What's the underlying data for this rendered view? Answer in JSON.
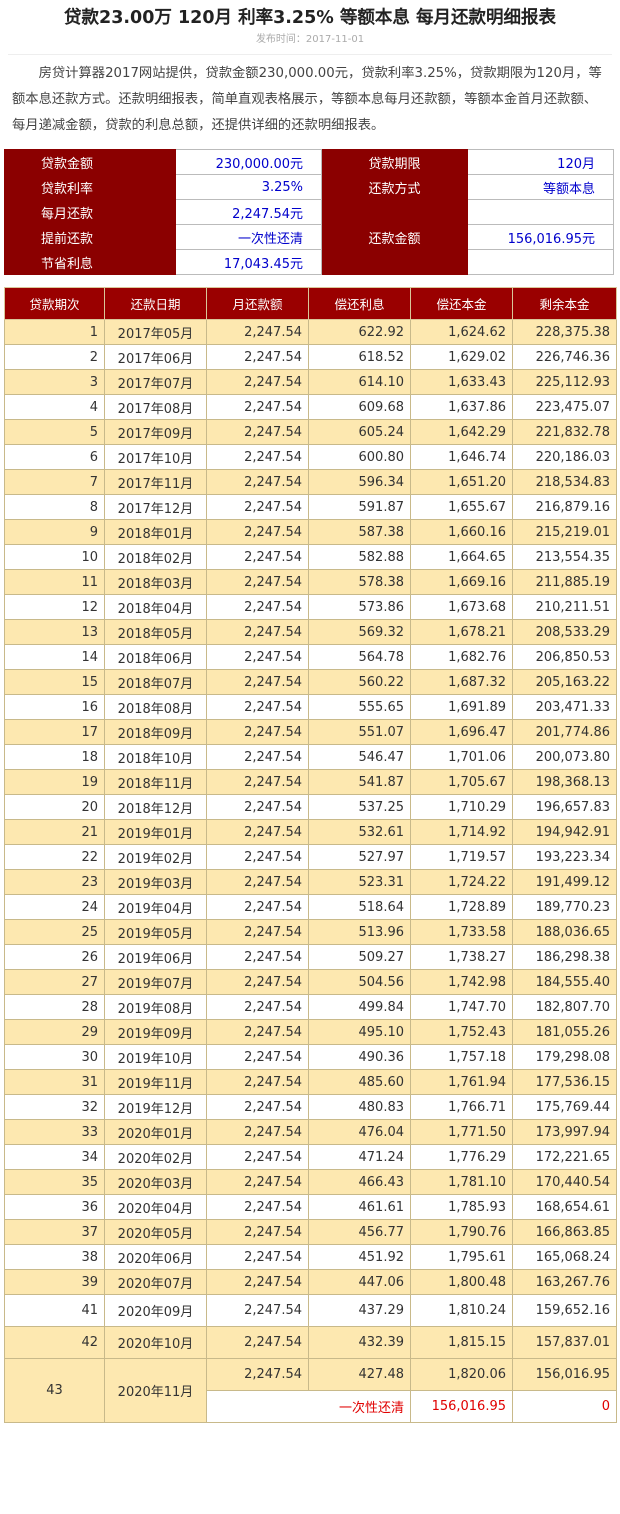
{
  "article": {
    "title": "贷款23.00万 120月 利率3.25% 等额本息 每月还款明细报表",
    "publish_date": "发布时间：2017-11-01",
    "intro": "房贷计算器2017网站提供，贷款金额230,000.00元，贷款利率3.25%，贷款期限为120月，等额本息还款方式。还款明细报表，简单直观表格展示，等额本息每月还款额，等额本金首月还款额、每月递减金额，贷款的利息总额，还提供详细的还款明细报表。"
  },
  "summary": {
    "loan_amount_label": "贷款金额",
    "loan_amount": "230,000.00元",
    "term_label": "贷款期限",
    "term": "120月",
    "rate_label": "贷款利率",
    "rate": "3.25%",
    "method_label": "还款方式",
    "method": "等额本息",
    "monthly_label": "每月还款",
    "monthly": "2,247.54元",
    "prepay_label": "提前还款",
    "prepay": "一次性还清",
    "prepay_amount_label": "还款金额",
    "prepay_amount": "156,016.95元",
    "saved_label": "节省利息",
    "saved": "17,043.45元"
  },
  "schedule": {
    "headers": [
      "贷款期次",
      "还款日期",
      "月还款额",
      "偿还利息",
      "偿还本金",
      "剩余本金"
    ],
    "rows": [
      [
        "1",
        "2017年05月",
        "2,247.54",
        "622.92",
        "1,624.62",
        "228,375.38"
      ],
      [
        "2",
        "2017年06月",
        "2,247.54",
        "618.52",
        "1,629.02",
        "226,746.36"
      ],
      [
        "3",
        "2017年07月",
        "2,247.54",
        "614.10",
        "1,633.43",
        "225,112.93"
      ],
      [
        "4",
        "2017年08月",
        "2,247.54",
        "609.68",
        "1,637.86",
        "223,475.07"
      ],
      [
        "5",
        "2017年09月",
        "2,247.54",
        "605.24",
        "1,642.29",
        "221,832.78"
      ],
      [
        "6",
        "2017年10月",
        "2,247.54",
        "600.80",
        "1,646.74",
        "220,186.03"
      ],
      [
        "7",
        "2017年11月",
        "2,247.54",
        "596.34",
        "1,651.20",
        "218,534.83"
      ],
      [
        "8",
        "2017年12月",
        "2,247.54",
        "591.87",
        "1,655.67",
        "216,879.16"
      ],
      [
        "9",
        "2018年01月",
        "2,247.54",
        "587.38",
        "1,660.16",
        "215,219.01"
      ],
      [
        "10",
        "2018年02月",
        "2,247.54",
        "582.88",
        "1,664.65",
        "213,554.35"
      ],
      [
        "11",
        "2018年03月",
        "2,247.54",
        "578.38",
        "1,669.16",
        "211,885.19"
      ],
      [
        "12",
        "2018年04月",
        "2,247.54",
        "573.86",
        "1,673.68",
        "210,211.51"
      ],
      [
        "13",
        "2018年05月",
        "2,247.54",
        "569.32",
        "1,678.21",
        "208,533.29"
      ],
      [
        "14",
        "2018年06月",
        "2,247.54",
        "564.78",
        "1,682.76",
        "206,850.53"
      ],
      [
        "15",
        "2018年07月",
        "2,247.54",
        "560.22",
        "1,687.32",
        "205,163.22"
      ],
      [
        "16",
        "2018年08月",
        "2,247.54",
        "555.65",
        "1,691.89",
        "203,471.33"
      ],
      [
        "17",
        "2018年09月",
        "2,247.54",
        "551.07",
        "1,696.47",
        "201,774.86"
      ],
      [
        "18",
        "2018年10月",
        "2,247.54",
        "546.47",
        "1,701.06",
        "200,073.80"
      ],
      [
        "19",
        "2018年11月",
        "2,247.54",
        "541.87",
        "1,705.67",
        "198,368.13"
      ],
      [
        "20",
        "2018年12月",
        "2,247.54",
        "537.25",
        "1,710.29",
        "196,657.83"
      ],
      [
        "21",
        "2019年01月",
        "2,247.54",
        "532.61",
        "1,714.92",
        "194,942.91"
      ],
      [
        "22",
        "2019年02月",
        "2,247.54",
        "527.97",
        "1,719.57",
        "193,223.34"
      ],
      [
        "23",
        "2019年03月",
        "2,247.54",
        "523.31",
        "1,724.22",
        "191,499.12"
      ],
      [
        "24",
        "2019年04月",
        "2,247.54",
        "518.64",
        "1,728.89",
        "189,770.23"
      ],
      [
        "25",
        "2019年05月",
        "2,247.54",
        "513.96",
        "1,733.58",
        "188,036.65"
      ],
      [
        "26",
        "2019年06月",
        "2,247.54",
        "509.27",
        "1,738.27",
        "186,298.38"
      ],
      [
        "27",
        "2019年07月",
        "2,247.54",
        "504.56",
        "1,742.98",
        "184,555.40"
      ],
      [
        "28",
        "2019年08月",
        "2,247.54",
        "499.84",
        "1,747.70",
        "182,807.70"
      ],
      [
        "29",
        "2019年09月",
        "2,247.54",
        "495.10",
        "1,752.43",
        "181,055.26"
      ],
      [
        "30",
        "2019年10月",
        "2,247.54",
        "490.36",
        "1,757.18",
        "179,298.08"
      ],
      [
        "31",
        "2019年11月",
        "2,247.54",
        "485.60",
        "1,761.94",
        "177,536.15"
      ],
      [
        "32",
        "2019年12月",
        "2,247.54",
        "480.83",
        "1,766.71",
        "175,769.44"
      ],
      [
        "33",
        "2020年01月",
        "2,247.54",
        "476.04",
        "1,771.50",
        "173,997.94"
      ],
      [
        "34",
        "2020年02月",
        "2,247.54",
        "471.24",
        "1,776.29",
        "172,221.65"
      ],
      [
        "35",
        "2020年03月",
        "2,247.54",
        "466.43",
        "1,781.10",
        "170,440.54"
      ],
      [
        "36",
        "2020年04月",
        "2,247.54",
        "461.61",
        "1,785.93",
        "168,654.61"
      ],
      [
        "37",
        "2020年05月",
        "2,247.54",
        "456.77",
        "1,790.76",
        "166,863.85"
      ],
      [
        "38",
        "2020年06月",
        "2,247.54",
        "451.92",
        "1,795.61",
        "165,068.24"
      ],
      [
        "39",
        "2020年07月",
        "2,247.54",
        "447.06",
        "1,800.48",
        "163,267.76"
      ],
      [
        "41",
        "2020年09月",
        "2,247.54",
        "437.29",
        "1,810.24",
        "159,652.16"
      ],
      [
        "42",
        "2020年10月",
        "2,247.54",
        "432.39",
        "1,815.15",
        "157,837.01"
      ]
    ],
    "last": {
      "period": "43",
      "date": "2020年11月",
      "payment": "2,247.54",
      "interest": "427.48",
      "principal": "1,820.06",
      "remaining": "156,016.95",
      "prepay_label": "一次性还清",
      "prepay_amount": "156,016.95",
      "prepay_remaining": "0"
    }
  }
}
